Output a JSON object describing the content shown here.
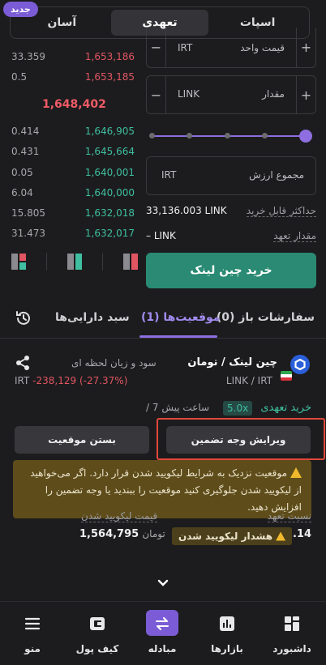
{
  "top_tabs": [
    "اسپات",
    "تعهدی",
    "آسان"
  ],
  "active_tab": "تعهدی",
  "new_badge": "جدید",
  "order_book": {
    "sells": [
      {
        "amount": "33.359",
        "price": "1,653,186"
      },
      {
        "amount": "0.5",
        "price": "1,653,185"
      }
    ],
    "mid_price": "1,648,402",
    "buys": [
      {
        "amount": "0.414",
        "price": "1,646,905"
      },
      {
        "amount": "0.431",
        "price": "1,645,664"
      },
      {
        "amount": "0.05",
        "price": "1,640,001"
      },
      {
        "amount": "6.04",
        "price": "1,640,000"
      },
      {
        "amount": "15.805",
        "price": "1,632,018"
      },
      {
        "amount": "31.473",
        "price": "1,632,017"
      }
    ]
  },
  "form": {
    "unit_price_label": "قیمت واحد",
    "unit_price_unit": "IRT",
    "amount_label": "مقدار",
    "amount_unit": "LINK",
    "total_label": "مجموع ارزش",
    "total_unit": "IRT",
    "stepper_minus": "−",
    "stepper_plus": "+",
    "max_buy_label": "حداکثر قابل خرید",
    "max_buy_value": "33,136.003 LINK",
    "margin_amount_label": "مقدار تعهد",
    "margin_amount_value": "– LINK",
    "buy_button": "خرید چین لینک"
  },
  "position_tabs": {
    "open_orders": "سفارشات باز (0)",
    "positions": "موقعیت‌ها (1)",
    "portfolio": "سبد دارایی‌ها"
  },
  "position": {
    "name": "چین لینک / تومان",
    "pair": "LINK / IRT",
    "pnl_label": "سود و زیان لحظه ای",
    "pnl_value": "-238,129 (-27.37%)",
    "pnl_unit": "IRT",
    "type": "خرید تعهدی",
    "leverage": "5.0x",
    "time": "/ 7 ساعت پیش",
    "edit_margin_button": "ویرایش وجه تضمین",
    "close_button": "بستن موقعیت",
    "warning_lines": [
      "موقعیت نزدیک به شرایط لیکویید شدن قرار دارد. اگر می‌خواهید",
      "از لیکویید شدن جلوگیری کنید موقعیت را ببندید یا وجه تضمین را",
      "افزایش دهید."
    ],
    "margin_ratio_label": "نسبت تعهد",
    "margin_ratio_value": "1.14",
    "liq_warning": "هشدار لیکویید شدن",
    "liq_price_label": "قیمت لیکویید شدن",
    "liq_price_value": "1,564,795",
    "liq_price_unit": "تومان"
  },
  "bottom_nav": [
    {
      "label": "داشبورد",
      "icon": "dashboard-icon"
    },
    {
      "label": "بازارها",
      "icon": "markets-icon"
    },
    {
      "label": "مبادله",
      "icon": "exchange-icon"
    },
    {
      "label": "کیف پول",
      "icon": "wallet-icon"
    },
    {
      "label": "منو",
      "icon": "menu-icon"
    }
  ],
  "colors": {
    "accent": "#7c5cd6",
    "buy": "#3fbfa0",
    "sell": "#e05561",
    "warning_bg": "#5e4d1b"
  }
}
